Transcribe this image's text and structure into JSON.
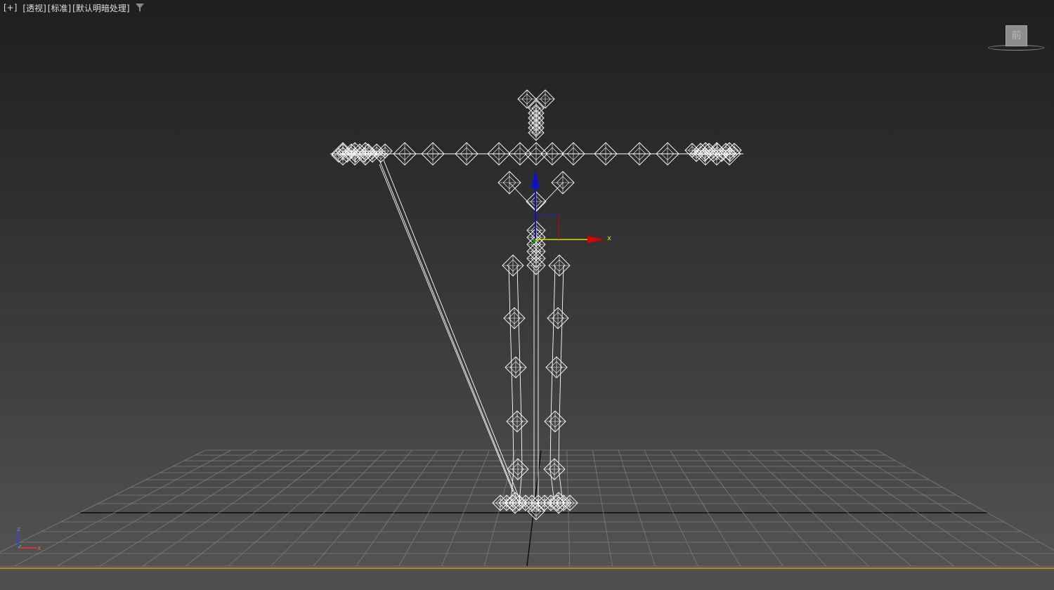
{
  "viewport": {
    "labels": [
      "[+]",
      "[透视]",
      "[标准]",
      "[默认明暗处理]"
    ],
    "filter_icon": "filter-icon",
    "view_cube_face": "前",
    "gizmo_axis_x": "x",
    "tripod": {
      "z": "z",
      "x": "x"
    }
  },
  "colors": {
    "background_top": "#1f1f1f",
    "background_bottom": "#555555",
    "grid": "#7d7d7d",
    "grid_axis": "#000000",
    "wireframe": "#ffffff",
    "gizmo_x": "#e00000",
    "gizmo_y": "#00a000",
    "gizmo_z": "#1010c8",
    "gizmo_plane": "#ffff00",
    "timeline_border": "#b58a1b"
  }
}
